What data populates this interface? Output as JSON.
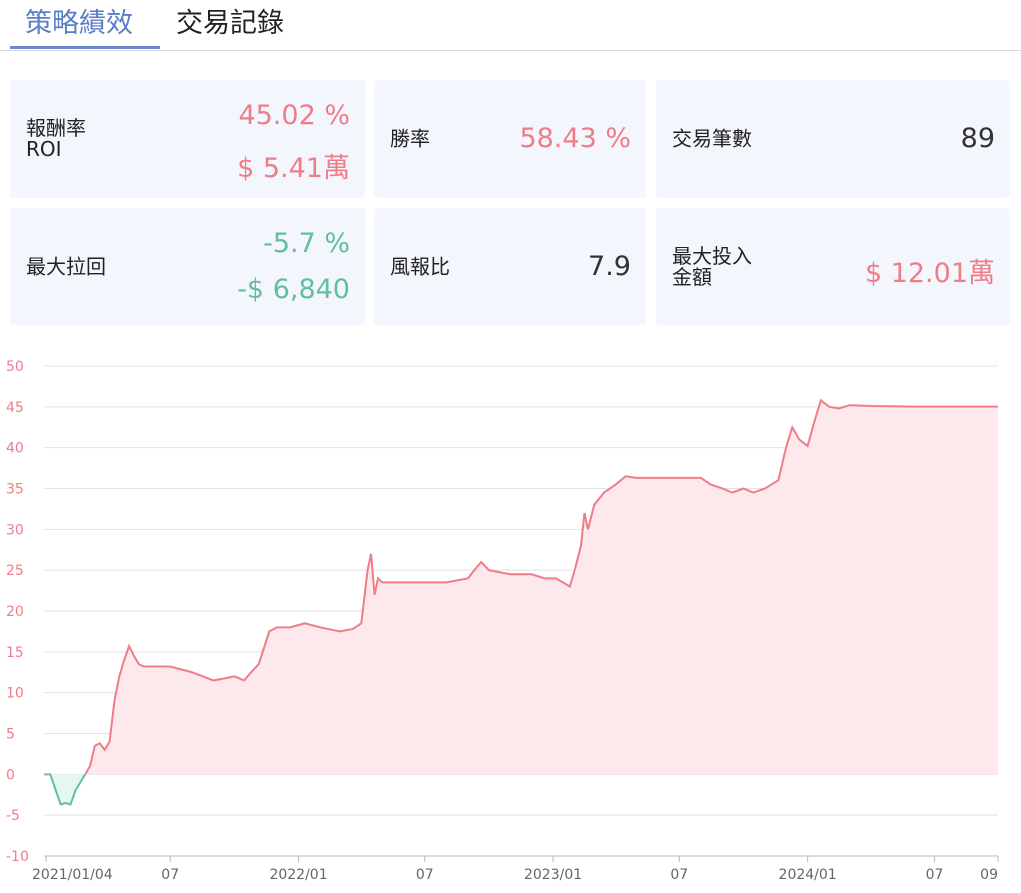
{
  "tabs": [
    {
      "label": "策略績效",
      "active": true
    },
    {
      "label": "交易記錄",
      "active": false
    }
  ],
  "stats": {
    "roi": {
      "label_line1": "報酬率",
      "label_line2": "ROI",
      "percent": "45.02 %",
      "amount": "$ 5.41萬"
    },
    "win_rate": {
      "label": "勝率",
      "value": "58.43 %"
    },
    "trade_count": {
      "label": "交易筆數",
      "value": "89"
    },
    "max_drawdown": {
      "label": "最大拉回",
      "percent": "-5.7 %",
      "amount": "-$ 6,840"
    },
    "risk_reward": {
      "label": "風報比",
      "value": "7.9"
    },
    "max_investment": {
      "label_line1": "最大投入",
      "label_line2": "金額",
      "value": "$ 12.01萬"
    }
  },
  "colors": {
    "positive": "#ef7d87",
    "negative": "#5fbf9f",
    "tab_active": "#5a7fc7",
    "card_bg": "#f3f6fd",
    "area_fill": "#fde8ec",
    "neg_area_fill": "#e6f6f0"
  },
  "chart_data": {
    "type": "area",
    "ylim": [
      -10,
      50
    ],
    "yticks": [
      -10,
      -5,
      0,
      5,
      10,
      15,
      20,
      25,
      30,
      35,
      40,
      45,
      50
    ],
    "xlim": [
      "2021-01-01",
      "2024-09-30"
    ],
    "xticks": [
      {
        "date": "2021-01-04",
        "label": "2021/01/04"
      },
      {
        "date": "2021-07-01",
        "label": "07"
      },
      {
        "date": "2022-01-01",
        "label": "2022/01"
      },
      {
        "date": "2022-07-01",
        "label": "07"
      },
      {
        "date": "2023-01-01",
        "label": "2023/01"
      },
      {
        "date": "2023-07-01",
        "label": "07"
      },
      {
        "date": "2024-01-01",
        "label": "2024/01"
      },
      {
        "date": "2024-07-01",
        "label": "07"
      },
      {
        "date": "2024-09-30",
        "label": "09"
      }
    ],
    "series": [
      {
        "x": [
          "2021-01-01",
          "2021-01-10",
          "2021-01-18",
          "2021-01-25",
          "2021-02-01",
          "2021-02-08",
          "2021-02-15",
          "2021-02-22",
          "2021-03-01",
          "2021-03-08",
          "2021-03-15",
          "2021-03-22",
          "2021-03-29",
          "2021-04-05",
          "2021-04-12",
          "2021-04-19",
          "2021-04-26",
          "2021-05-03",
          "2021-05-10",
          "2021-05-17",
          "2021-05-24",
          "2021-06-07",
          "2021-07-01",
          "2021-08-01",
          "2021-09-01",
          "2021-09-20",
          "2021-10-01",
          "2021-10-15",
          "2021-10-25",
          "2021-11-05",
          "2021-11-20",
          "2021-12-01",
          "2021-12-20",
          "2022-01-10",
          "2022-02-01",
          "2022-03-01",
          "2022-03-20",
          "2022-04-01",
          "2022-04-10",
          "2022-04-15",
          "2022-04-20",
          "2022-04-25",
          "2022-05-01",
          "2022-05-10",
          "2022-06-01",
          "2022-07-01",
          "2022-08-01",
          "2022-09-01",
          "2022-09-10",
          "2022-09-20",
          "2022-10-01",
          "2022-11-01",
          "2022-12-01",
          "2022-12-20",
          "2023-01-05",
          "2023-01-15",
          "2023-01-25",
          "2023-02-01",
          "2023-02-10",
          "2023-02-15",
          "2023-02-20",
          "2023-03-01",
          "2023-03-15",
          "2023-04-01",
          "2023-04-15",
          "2023-05-01",
          "2023-06-01",
          "2023-07-01",
          "2023-08-01",
          "2023-08-15",
          "2023-09-01",
          "2023-09-15",
          "2023-10-01",
          "2023-10-15",
          "2023-11-01",
          "2023-11-10",
          "2023-11-20",
          "2023-12-01",
          "2023-12-10",
          "2023-12-20",
          "2024-01-01",
          "2024-01-10",
          "2024-01-20",
          "2024-02-01",
          "2024-02-15",
          "2024-03-01",
          "2024-04-01",
          "2024-06-01",
          "2024-08-01",
          "2024-09-30"
        ],
        "values": [
          0,
          0,
          -2,
          -3.7,
          -3.5,
          -3.7,
          -2,
          -1,
          0,
          1,
          3.5,
          3.8,
          3,
          4,
          9,
          12,
          14,
          15.7,
          14.5,
          13.5,
          13.2,
          13.2,
          13.2,
          12.5,
          11.5,
          11.8,
          12,
          11.5,
          12.5,
          13.5,
          17.5,
          18,
          18,
          18.5,
          18,
          17.5,
          17.8,
          18.5,
          25,
          27,
          22,
          24,
          23.5,
          23.5,
          23.5,
          23.5,
          23.5,
          24,
          25,
          26,
          25,
          24.5,
          24.5,
          24,
          24,
          23.5,
          23,
          25,
          28,
          32,
          30,
          33,
          34.5,
          35.5,
          36.5,
          36.3,
          36.3,
          36.3,
          36.3,
          35.5,
          35,
          34.5,
          35,
          34.5,
          35,
          35.5,
          36,
          40,
          42.5,
          41,
          40.2,
          43,
          45.8,
          45,
          44.8,
          45.2,
          45.1,
          45.02,
          45.02,
          45.02
        ]
      }
    ]
  }
}
